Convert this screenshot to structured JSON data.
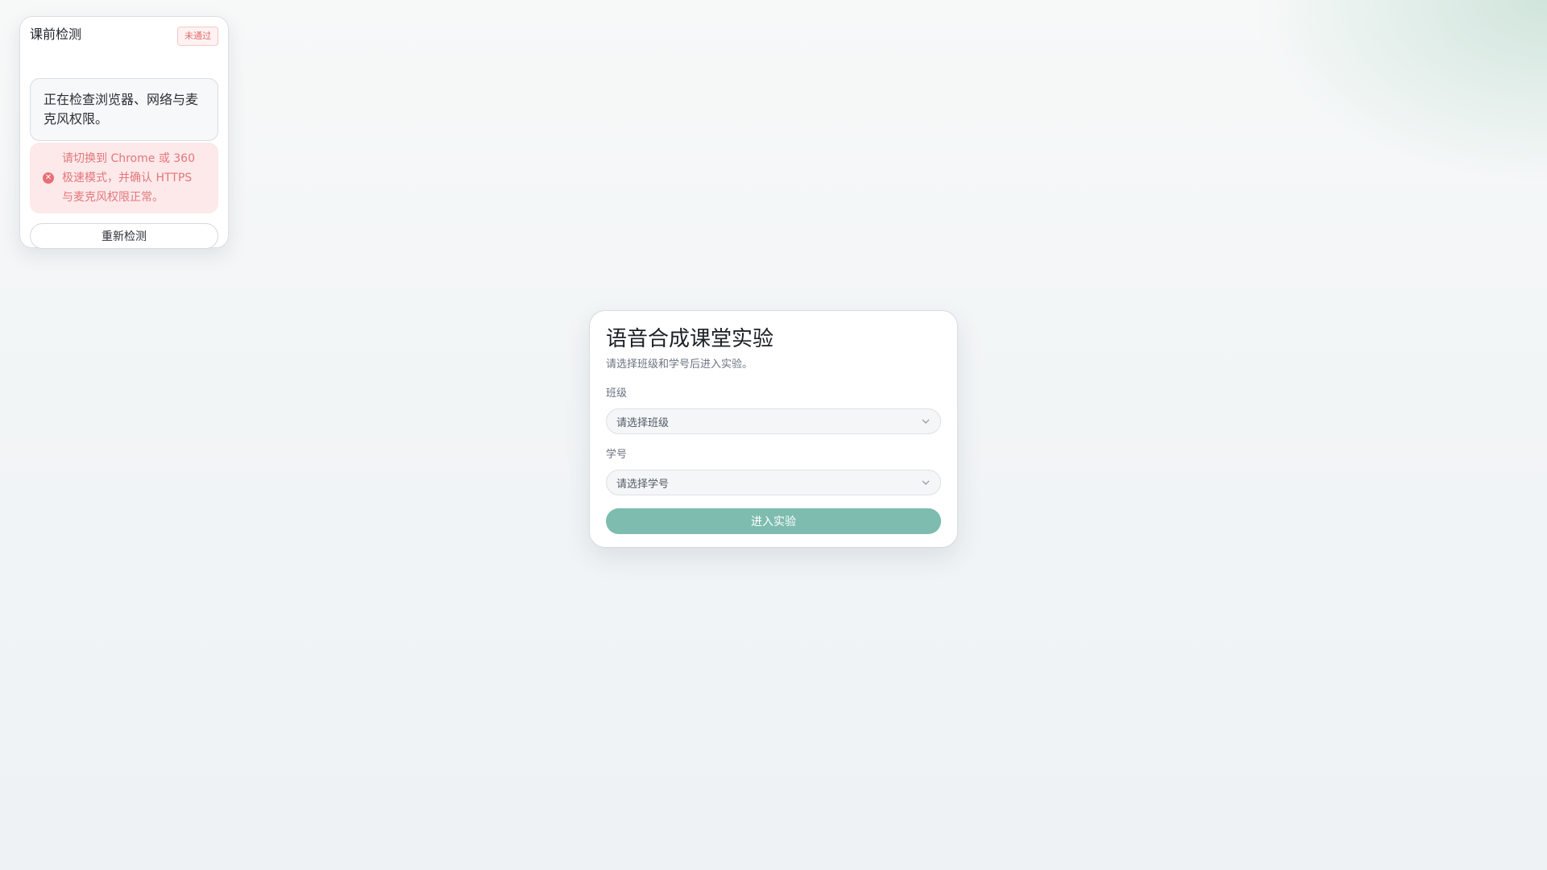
{
  "precheck": {
    "title": "课前检测",
    "status_badge": "未通过",
    "status_message": "正在检查浏览器、网络与麦克风权限。",
    "error_icon": "error-circle-icon",
    "error_message": "请切换到 Chrome 或 360 极速模式，并确认 HTTPS 与麦克风权限正常。",
    "recheck_label": "重新检测"
  },
  "main": {
    "title": "语音合成课堂实验",
    "subtitle": "请选择班级和学号后进入实验。",
    "class_field": {
      "label": "班级",
      "placeholder": "请选择班级",
      "icon": "chevron-down-icon"
    },
    "student_field": {
      "label": "学号",
      "placeholder": "请选择学号",
      "icon": "chevron-down-icon"
    },
    "enter_label": "进入实验"
  },
  "colors": {
    "accent": "#7dbcaf",
    "error": "#e2777c",
    "error_bg": "#fde9ea"
  }
}
